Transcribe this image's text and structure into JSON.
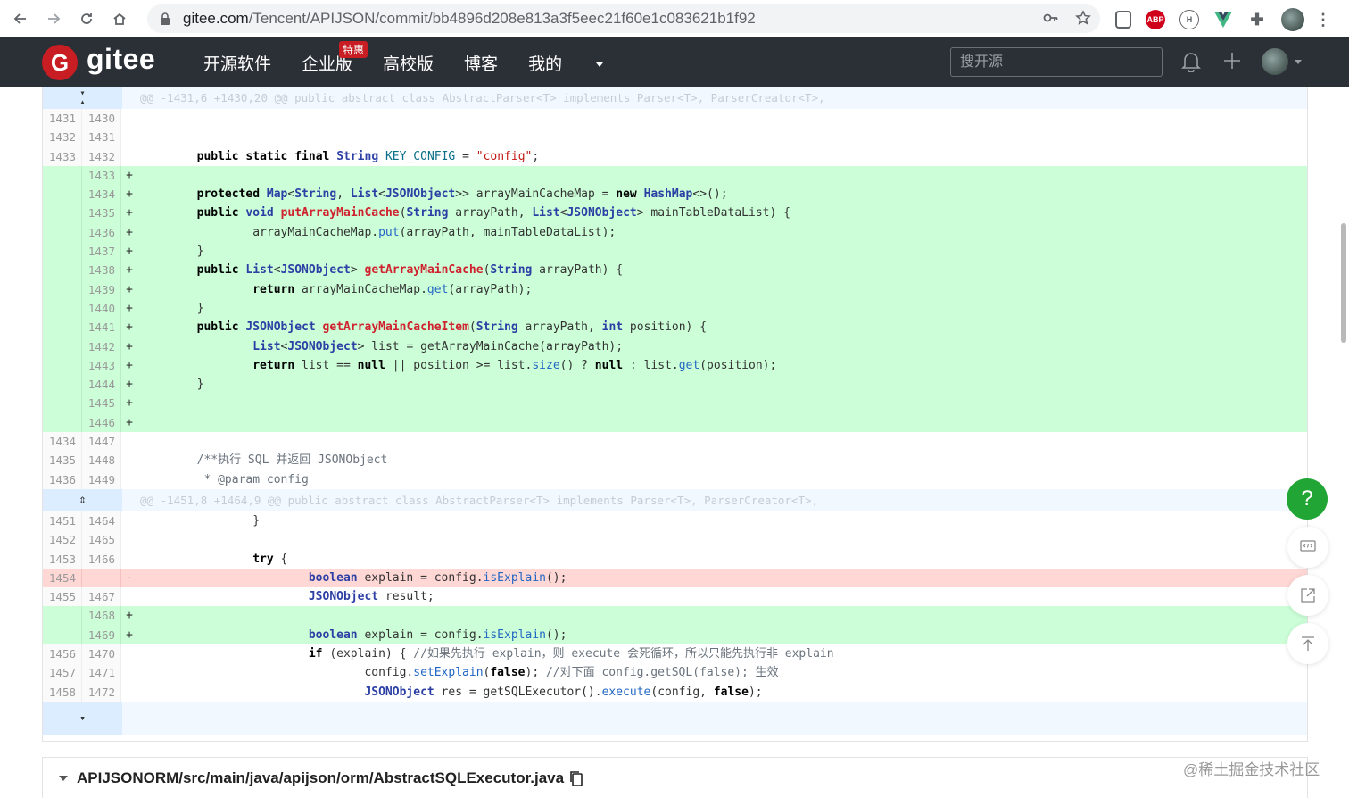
{
  "browser": {
    "url_host": "gitee.com",
    "url_path": "/Tencent/APIJSON/commit/bb4896d208e813a3f5eec21f60e1c083621b1f92",
    "extensions": [
      "shield-icon",
      "abp-icon",
      "h-icon",
      "vue-icon",
      "puzzle-icon",
      "profile-avatar"
    ],
    "abp_label": "ABP"
  },
  "header": {
    "logo_letter": "G",
    "logo_text": "gitee",
    "nav": [
      "开源软件",
      "企业版",
      "高校版",
      "博客",
      "我的"
    ],
    "promo_badge": "特惠",
    "search_placeholder": "搜开源"
  },
  "diff": {
    "hunk1": "@@ -1431,6 +1430,20 @@ public abstract class AbstractParser<T> implements Parser<T>, ParserCreator<T>,",
    "hunk2": "@@ -1451,8 +1464,9 @@ public abstract class AbstractParser<T> implements Parser<T>, ParserCreator<T>,",
    "rows": [
      {
        "type": "ctx",
        "old": "1431",
        "new": "1430",
        "sign": "",
        "code": ""
      },
      {
        "type": "ctx",
        "old": "1432",
        "new": "1431",
        "sign": "",
        "code": ""
      },
      {
        "type": "ctx",
        "old": "1433",
        "new": "1432",
        "sign": "",
        "code": "        public static final String KEY_CONFIG = \"config\";"
      },
      {
        "type": "add",
        "old": "",
        "new": "1433",
        "sign": "+",
        "code": ""
      },
      {
        "type": "add",
        "old": "",
        "new": "1434",
        "sign": "+",
        "code": "        protected Map<String, List<JSONObject>> arrayMainCacheMap = new HashMap<>();"
      },
      {
        "type": "add",
        "old": "",
        "new": "1435",
        "sign": "+",
        "code": "        public void putArrayMainCache(String arrayPath, List<JSONObject> mainTableDataList) {"
      },
      {
        "type": "add",
        "old": "",
        "new": "1436",
        "sign": "+",
        "code": "                arrayMainCacheMap.put(arrayPath, mainTableDataList);"
      },
      {
        "type": "add",
        "old": "",
        "new": "1437",
        "sign": "+",
        "code": "        }"
      },
      {
        "type": "add",
        "old": "",
        "new": "1438",
        "sign": "+",
        "code": "        public List<JSONObject> getArrayMainCache(String arrayPath) {"
      },
      {
        "type": "add",
        "old": "",
        "new": "1439",
        "sign": "+",
        "code": "                return arrayMainCacheMap.get(arrayPath);"
      },
      {
        "type": "add",
        "old": "",
        "new": "1440",
        "sign": "+",
        "code": "        }"
      },
      {
        "type": "add",
        "old": "",
        "new": "1441",
        "sign": "+",
        "code": "        public JSONObject getArrayMainCacheItem(String arrayPath, int position) {"
      },
      {
        "type": "add",
        "old": "",
        "new": "1442",
        "sign": "+",
        "code": "                List<JSONObject> list = getArrayMainCache(arrayPath);"
      },
      {
        "type": "add",
        "old": "",
        "new": "1443",
        "sign": "+",
        "code": "                return list == null || position >= list.size() ? null : list.get(position);"
      },
      {
        "type": "add",
        "old": "",
        "new": "1444",
        "sign": "+",
        "code": "        }"
      },
      {
        "type": "add",
        "old": "",
        "new": "1445",
        "sign": "+",
        "code": ""
      },
      {
        "type": "add",
        "old": "",
        "new": "1446",
        "sign": "+",
        "code": ""
      },
      {
        "type": "ctx",
        "old": "1434",
        "new": "1447",
        "sign": "",
        "code": ""
      },
      {
        "type": "ctx",
        "old": "1435",
        "new": "1448",
        "sign": "",
        "code": "        /**执行 SQL 并返回 JSONObject"
      },
      {
        "type": "ctx",
        "old": "1436",
        "new": "1449",
        "sign": "",
        "code": "         * @param config"
      }
    ],
    "rows2": [
      {
        "type": "ctx",
        "old": "1451",
        "new": "1464",
        "sign": "",
        "code": "                }"
      },
      {
        "type": "ctx",
        "old": "1452",
        "new": "1465",
        "sign": "",
        "code": ""
      },
      {
        "type": "ctx",
        "old": "1453",
        "new": "1466",
        "sign": "",
        "code": "                try {"
      },
      {
        "type": "del",
        "old": "1454",
        "new": "",
        "sign": "-",
        "code": "                        boolean explain = config.isExplain();"
      },
      {
        "type": "ctx",
        "old": "1455",
        "new": "1467",
        "sign": "",
        "code": "                        JSONObject result;"
      },
      {
        "type": "add",
        "old": "",
        "new": "1468",
        "sign": "+",
        "code": ""
      },
      {
        "type": "add",
        "old": "",
        "new": "1469",
        "sign": "+",
        "code": "                        boolean explain = config.isExplain();"
      },
      {
        "type": "ctx",
        "old": "1456",
        "new": "1470",
        "sign": "",
        "code": "                        if (explain) { //如果先执行 explain，则 execute 会死循环，所以只能先执行非 explain"
      },
      {
        "type": "ctx",
        "old": "1457",
        "new": "1471",
        "sign": "",
        "code": "                                config.setExplain(false); //对下面 config.getSQL(false); 生效"
      },
      {
        "type": "ctx",
        "old": "1458",
        "new": "1472",
        "sign": "",
        "code": "                                JSONObject res = getSQLExecutor().execute(config, false);"
      }
    ]
  },
  "fabs": {
    "help": "?"
  },
  "file": {
    "path": "APIJSONORM/src/main/java/apijson/orm/AbstractSQLExecutor.java"
  },
  "watermark": "@稀土掘金技术社区",
  "colors": {
    "add_bg": "#ccffd8",
    "del_bg": "#ffd7d5",
    "header_bg": "#2b2f36",
    "brand": "#c71d23",
    "help_green": "#21a635"
  }
}
